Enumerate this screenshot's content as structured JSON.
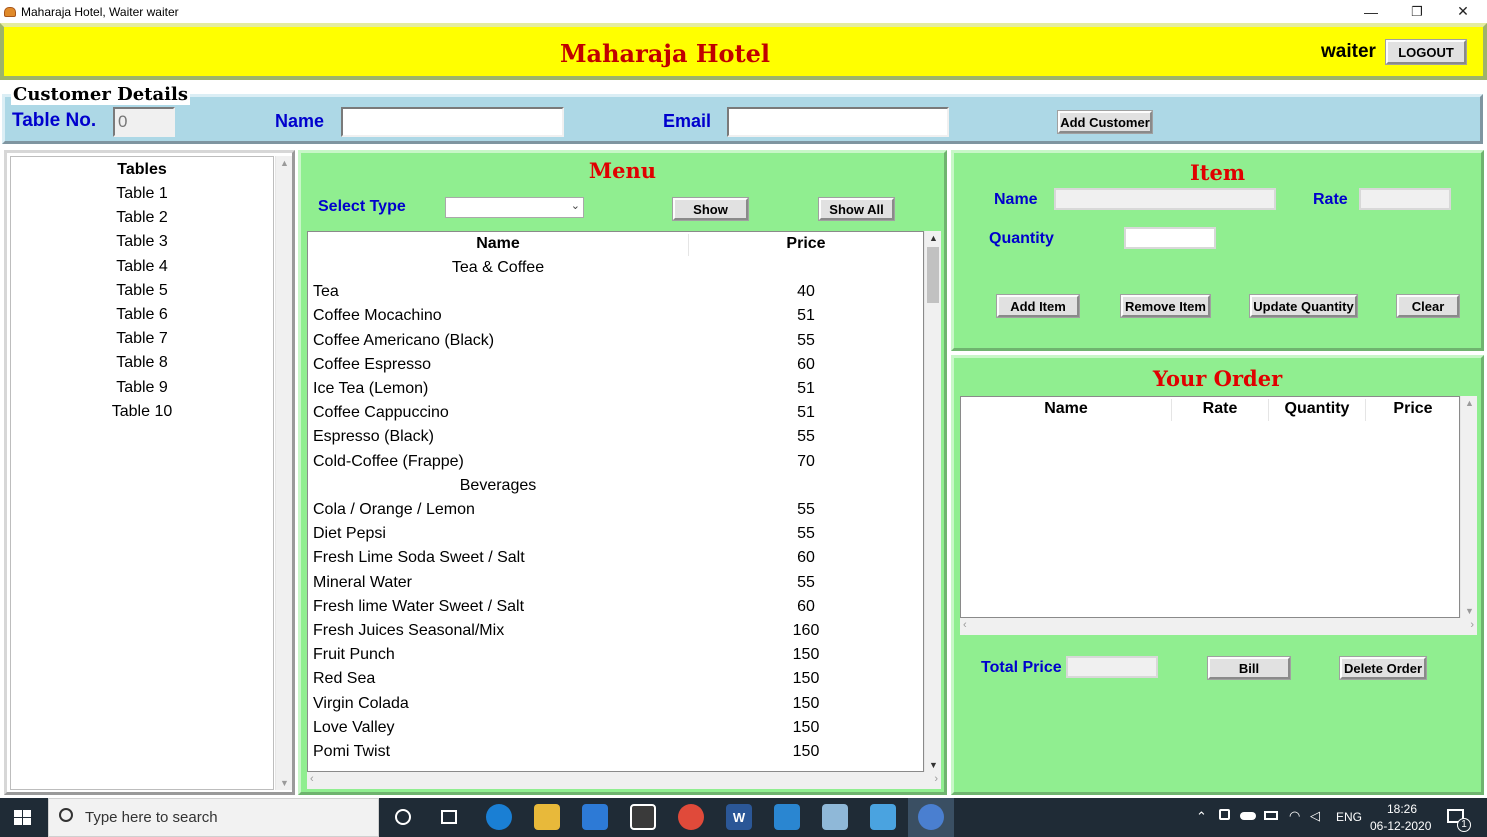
{
  "window": {
    "title": "Maharaja Hotel, Waiter waiter",
    "minimize": "—",
    "restore": "❐",
    "close": "✕"
  },
  "header": {
    "hotel_name": "Maharaja Hotel",
    "user": "waiter",
    "logout_label": "LOGOUT"
  },
  "customer": {
    "legend": "Customer Details",
    "table_no_label": "Table No.",
    "table_no_value": "0",
    "name_label": "Name",
    "name_value": "",
    "email_label": "Email",
    "email_value": "",
    "add_label": "Add Customer"
  },
  "tables": {
    "heading": "Tables",
    "items": [
      "Table 1",
      "Table 2",
      "Table 3",
      "Table 4",
      "Table 5",
      "Table 6",
      "Table 7",
      "Table 8",
      "Table 9",
      "Table 10"
    ]
  },
  "menu": {
    "title": "Menu",
    "select_type_label": "Select Type",
    "select_value": "",
    "show_label": "Show",
    "show_all_label": "Show All",
    "col_name": "Name",
    "col_price": "Price",
    "rows": [
      {
        "name": "Tea & Coffee",
        "price": "",
        "group": true
      },
      {
        "name": "Tea",
        "price": "40"
      },
      {
        "name": "Coffee Mocachino",
        "price": "51"
      },
      {
        "name": "Coffee Americano (Black)",
        "price": "55"
      },
      {
        "name": "Coffee Espresso",
        "price": "60"
      },
      {
        "name": "Ice Tea (Lemon)",
        "price": "51"
      },
      {
        "name": "Coffee Cappuccino",
        "price": "51"
      },
      {
        "name": "Espresso (Black)",
        "price": "55"
      },
      {
        "name": "Cold-Coffee (Frappe)",
        "price": "70"
      },
      {
        "name": "Beverages",
        "price": "",
        "group": true
      },
      {
        "name": "Cola / Orange / Lemon",
        "price": "55"
      },
      {
        "name": "Diet Pepsi",
        "price": "55"
      },
      {
        "name": "Fresh Lime Soda Sweet / Salt",
        "price": "60"
      },
      {
        "name": "Mineral Water",
        "price": "55"
      },
      {
        "name": "Fresh lime Water Sweet / Salt",
        "price": "60"
      },
      {
        "name": "Fresh Juices Seasonal/Mix",
        "price": "160"
      },
      {
        "name": "Fruit Punch",
        "price": "150"
      },
      {
        "name": "Red Sea",
        "price": "150"
      },
      {
        "name": "Virgin Colada",
        "price": "150"
      },
      {
        "name": "Love Valley",
        "price": "150"
      },
      {
        "name": "Pomi Twist",
        "price": "150"
      }
    ]
  },
  "item": {
    "title": "Item",
    "name_label": "Name",
    "rate_label": "Rate",
    "quantity_label": "Quantity",
    "name_value": "",
    "rate_value": "",
    "quantity_value": "",
    "add_label": "Add Item",
    "remove_label": "Remove Item",
    "update_label": "Update Quantity",
    "clear_label": "Clear"
  },
  "order": {
    "title": "Your Order",
    "col_name": "Name",
    "col_rate": "Rate",
    "col_quantity": "Quantity",
    "col_price": "Price",
    "total_label": "Total Price",
    "total_value": "",
    "bill_label": "Bill",
    "delete_label": "Delete Order"
  },
  "taskbar": {
    "search_placeholder": "Type here to search",
    "lang": "ENG",
    "time": "18:26",
    "date": "06-12-2020",
    "notification_count": "1"
  },
  "colors": {
    "header_bg": "#ffff00",
    "hotel_title": "#c00000",
    "customer_bg": "#add8e6",
    "panel_green": "#90ee90",
    "label_blue": "#0000cd",
    "panel_title_red": "#e00000",
    "taskbar_bg": "#1f2b36"
  }
}
